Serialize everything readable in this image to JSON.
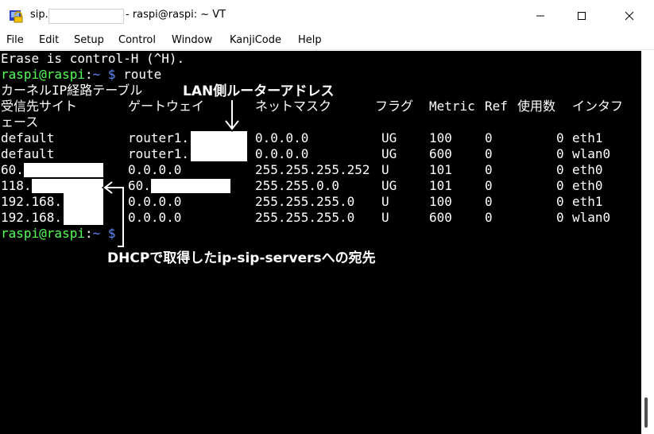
{
  "window": {
    "title_prefix": "sip.",
    "title_suffix": "- raspi@raspi: ~ VT"
  },
  "menu": {
    "file": "File",
    "edit": "Edit",
    "setup": "Setup",
    "control": "Control",
    "window": "Window",
    "kanjicode": "KanjiCode",
    "help": "Help"
  },
  "terminal": {
    "line_erase": "Erase is control-H (^H).",
    "prompt1_user": "raspi@raspi",
    "prompt1_sep": ":",
    "prompt1_path": "~ $",
    "prompt1_cmd": " route",
    "routing_title": "カーネルIP経路テーブル",
    "headers": [
      "受信先サイト",
      "ゲートウェイ",
      "ネットマスク",
      "フラグ",
      "Metric",
      "Ref",
      "使用数",
      "インタフ"
    ],
    "header_wrap": "ェース",
    "rows": [
      {
        "dest": "default",
        "gw": "router1.",
        "mask": "0.0.0.0",
        "flags": "UG",
        "metric": "100",
        "ref": "0",
        "use": "0",
        "iface": "eth1"
      },
      {
        "dest": "default",
        "gw": "router1.",
        "mask": "0.0.0.0",
        "flags": "UG",
        "metric": "600",
        "ref": "0",
        "use": "0",
        "iface": "wlan0"
      },
      {
        "dest": "60.",
        "gw": "0.0.0.0",
        "mask": "255.255.255.252",
        "flags": "U",
        "metric": "101",
        "ref": "0",
        "use": "0",
        "iface": "eth0"
      },
      {
        "dest": "118.",
        "gw": "60.",
        "mask": "255.255.0.0",
        "flags": "UG",
        "metric": "101",
        "ref": "0",
        "use": "0",
        "iface": "eth0"
      },
      {
        "dest": "192.168.",
        "gw": "0.0.0.0",
        "mask": "255.255.255.0",
        "flags": "U",
        "metric": "100",
        "ref": "0",
        "use": "0",
        "iface": "eth1"
      },
      {
        "dest": "192.168.",
        "gw": "0.0.0.0",
        "mask": "255.255.255.0",
        "flags": "U",
        "metric": "600",
        "ref": "0",
        "use": "0",
        "iface": "wlan0"
      }
    ],
    "prompt2_user": "raspi@raspi",
    "prompt2_sep": ":",
    "prompt2_path": "~ $"
  },
  "annotations": {
    "lan_router": "LAN側ルーターアドレス",
    "dhcp_servers": "DHCPで取得したip-sip-serversへの宛先"
  },
  "colors": {
    "terminal_bg": "#000000",
    "terminal_fg": "#ffffff",
    "prompt_green": "#55ff55",
    "prompt_blue": "#5b8cff"
  }
}
